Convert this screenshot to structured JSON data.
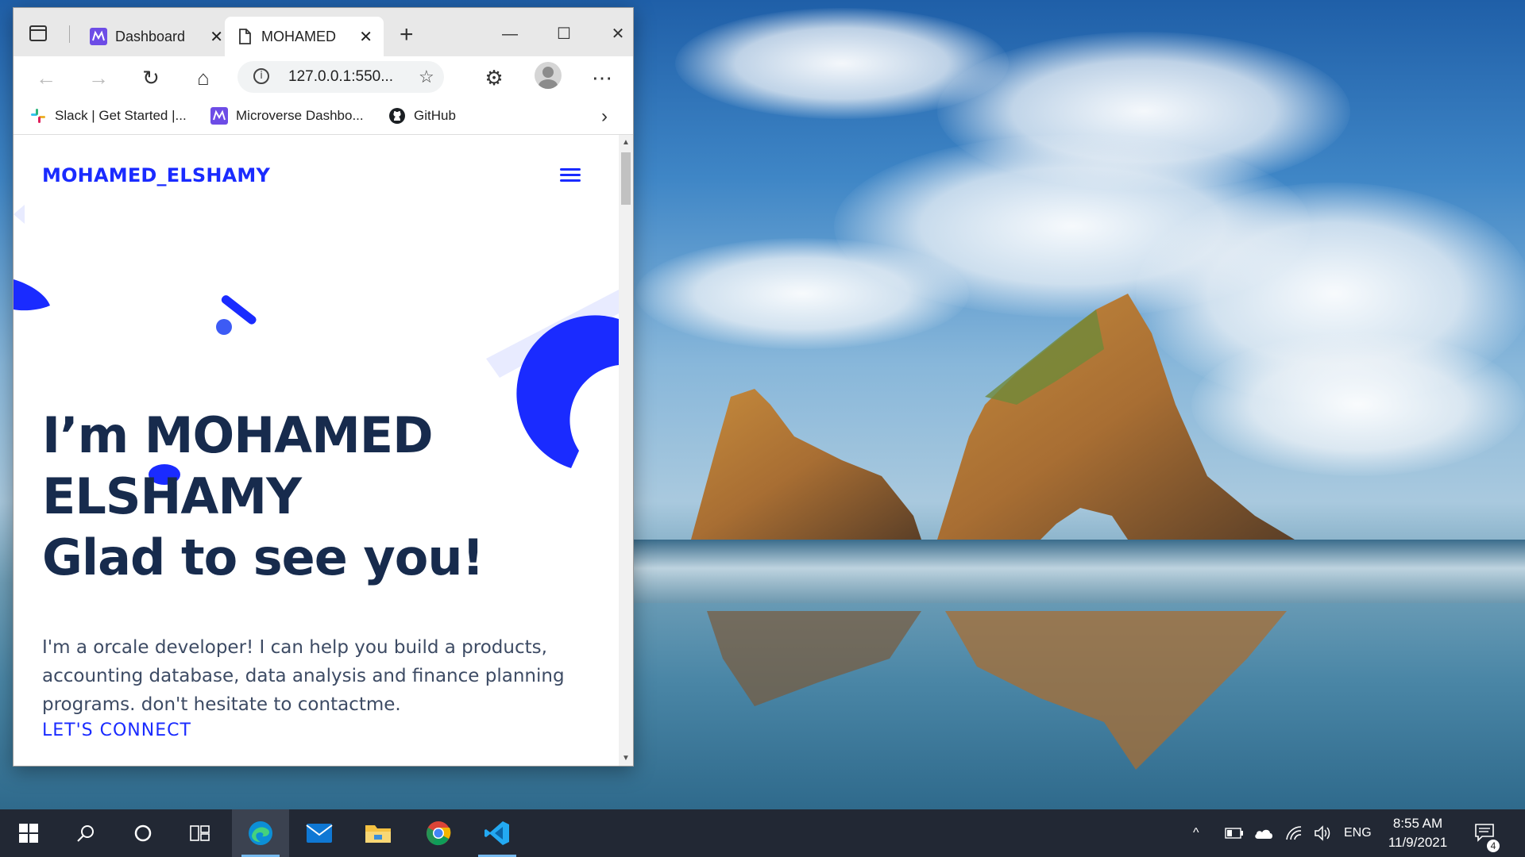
{
  "browser": {
    "tabs": [
      {
        "label": "Dashboard",
        "favicon": "microverse-icon"
      },
      {
        "label": "MOHAMED",
        "favicon": "page-icon",
        "active": true
      }
    ],
    "address": "127.0.0.1:550...",
    "favorites": [
      {
        "label": "Slack | Get Started |...",
        "icon": "slack-icon"
      },
      {
        "label": "Microverse Dashbo...",
        "icon": "microverse-icon"
      },
      {
        "label": "GitHub",
        "icon": "github-icon"
      }
    ]
  },
  "page": {
    "brand": "MOHAMED_ELSHAMY",
    "hero_line1": "I’m MOHAMED",
    "hero_line2": "ELSHAMY",
    "hero_line3": "Glad to see you!",
    "intro": "I'm a orcale developer! I can help you build a products, accounting database, data analysis and finance planning programs. don't hesitate to contactme.",
    "cta": "LET'S CONNECT",
    "accent_color": "#1a2bff",
    "heading_color": "#172b4d"
  },
  "taskbar": {
    "apps": [
      "edge-icon",
      "mail-icon",
      "file-explorer-icon",
      "chrome-icon",
      "vscode-icon"
    ],
    "language": "ENG",
    "time": "8:55 AM",
    "date": "11/9/2021",
    "notification_count": "4"
  }
}
